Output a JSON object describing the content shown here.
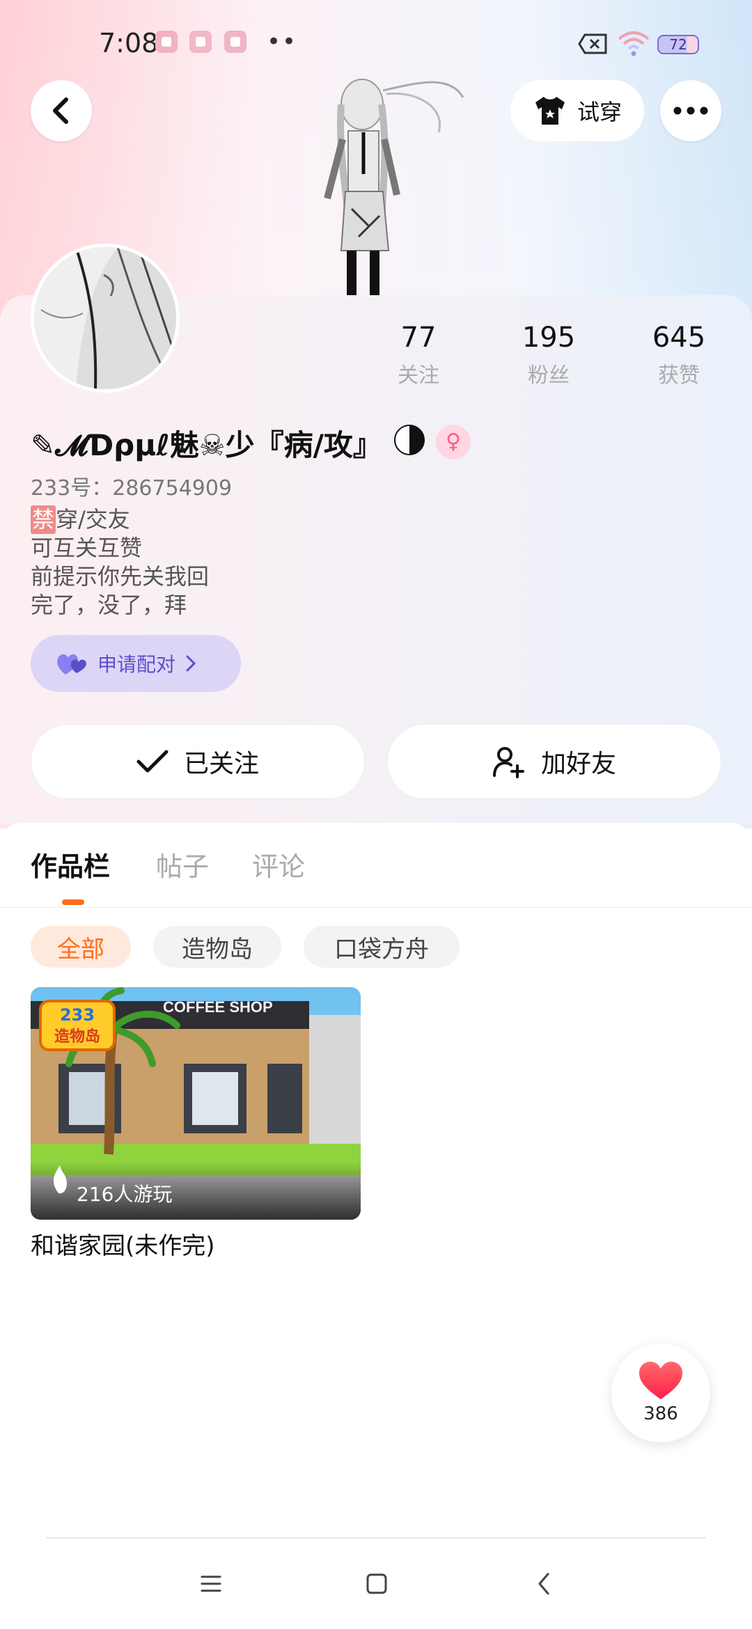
{
  "status_bar": {
    "time": "7:08",
    "notification_icons": [
      "app-notification-icon-1",
      "app-notification-icon-2",
      "app-notification-icon-3"
    ],
    "more": "••",
    "battery": "72"
  },
  "header": {
    "try_on_label": "试穿"
  },
  "profile": {
    "stats": [
      {
        "value": "77",
        "label": "关注"
      },
      {
        "value": "195",
        "label": "粉丝"
      },
      {
        "value": "645",
        "label": "获赞"
      }
    ],
    "username": "✎𝓜Ɗρμℓ魅☠少『病/攻』",
    "gender_symbol": "♀",
    "uid": "233号：286754909",
    "bio": {
      "badge": "禁",
      "lines": [
        "穿/交友",
        "可互关互赞",
        "前提示你先关我回",
        "完了，没了，拜"
      ]
    },
    "pair_button": "申请配对",
    "followed_button": "已关注",
    "add_friend_button": "加好友"
  },
  "tabs": [
    {
      "label": "作品栏",
      "active": true
    },
    {
      "label": "帖子",
      "active": false
    },
    {
      "label": "评论",
      "active": false
    }
  ],
  "filters": [
    {
      "label": "全部",
      "active": true
    },
    {
      "label": "造物岛",
      "active": false
    },
    {
      "label": "口袋方舟",
      "active": false
    }
  ],
  "works": [
    {
      "badge_number": "233",
      "badge_text": "造物岛",
      "sign_text": "COFFEE SHOP",
      "play_count": "216人游玩",
      "title": "和谐家园(未作完)"
    }
  ],
  "like_fab": {
    "count": "386"
  },
  "colors": {
    "accent_orange": "#ff6f1a",
    "pair_purple": "#5a4fc8",
    "heart_red": "#ff3b4f"
  }
}
